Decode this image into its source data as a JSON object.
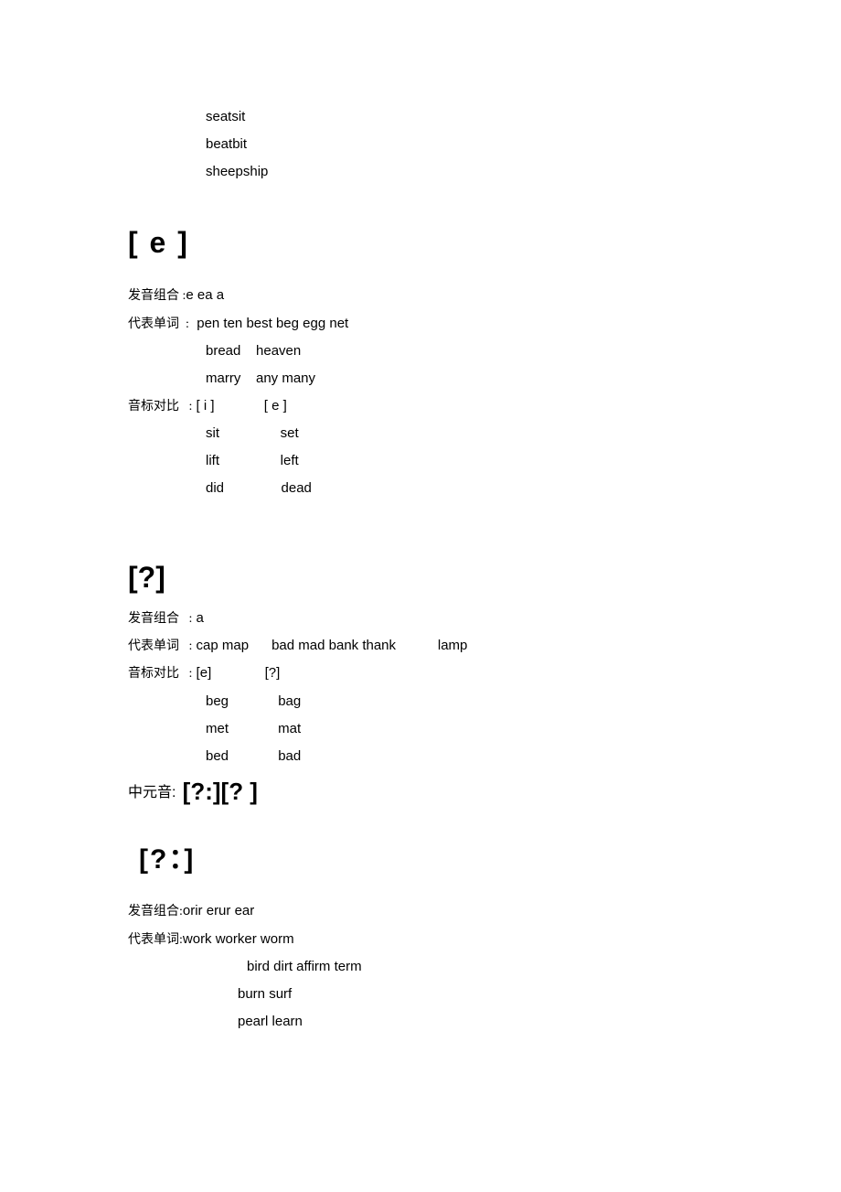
{
  "top_pairs": {
    "r1": "seatsit",
    "r2": "beatbit",
    "r3": "sheepship"
  },
  "e": {
    "heading": "[ e ]",
    "combo_label": "发音组合 :",
    "combo_val": "e ea a",
    "words_label": "代表单词  :",
    "words_r1": "  pen ten best beg egg net",
    "words_r2": "bread    heaven",
    "words_r3": "marry    any many",
    "cmp_label": "音标对比   :",
    "cmp_h": " [ i ]             [ e ]",
    "cmp_r1": "sit                set",
    "cmp_r2": "lift                left",
    "cmp_r3": "did               dead"
  },
  "ae": {
    "heading": "[?]",
    "combo_label": "发音组合   :",
    "combo_val": " a",
    "words_label": "代表单词   :",
    "words_val": " cap map      bad mad bank thank           lamp",
    "cmp_label": "音标对比   :",
    "cmp_h": " [e]              [?]",
    "cmp_r1": "beg             bag",
    "cmp_r2": "met             mat",
    "cmp_r3": "bed             bad"
  },
  "mid": {
    "label": "中元音:",
    "sym": " [?:][? ]"
  },
  "schwa": {
    "heading": "[?：]",
    "combo_label": "发音组合:",
    "combo_val": "orir erur ear",
    "words_label": "代表单词:",
    "words_r1": "work worker worm",
    "words_r2": "bird dirt affirm term",
    "words_r3": "burn surf",
    "words_r4": "pearl learn"
  }
}
